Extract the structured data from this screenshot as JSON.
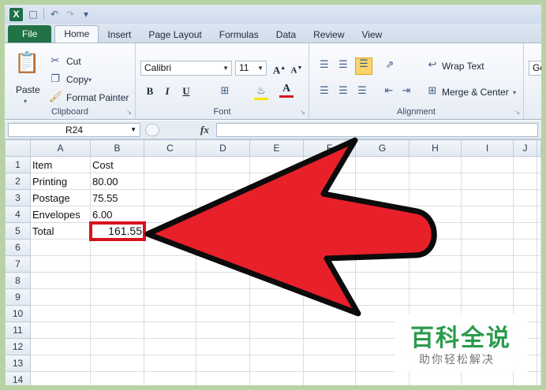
{
  "app": {
    "accent": "#217346",
    "highlight": "#d8121e"
  },
  "qat": {
    "logo": "X",
    "icons": [
      "save-icon",
      "undo-icon",
      "redo-icon",
      "customize-icon"
    ]
  },
  "tabs": [
    "File",
    "Home",
    "Insert",
    "Page Layout",
    "Formulas",
    "Data",
    "Review",
    "View"
  ],
  "ribbon": {
    "clipboard": {
      "paste": "Paste",
      "cut": "Cut",
      "copy": "Copy",
      "format_painter": "Format Painter",
      "label": "Clipboard"
    },
    "font": {
      "name": "Calibri",
      "size": "11",
      "label": "Font"
    },
    "alignment": {
      "wrap": "Wrap Text",
      "merge": "Merge & Center",
      "label": "Alignment"
    },
    "number": {
      "format": "Ge"
    }
  },
  "formula_bar": {
    "name_box": "R24",
    "fx": "fx",
    "value": ""
  },
  "grid": {
    "columns": [
      "A",
      "B",
      "C",
      "D",
      "E",
      "F",
      "G",
      "H",
      "I",
      "J"
    ],
    "rows": [
      {
        "n": "1",
        "a": "Item",
        "b": "Cost"
      },
      {
        "n": "2",
        "a": "Printing",
        "b": "80.00"
      },
      {
        "n": "3",
        "a": "Postage",
        "b": "75.55"
      },
      {
        "n": "4",
        "a": "Envelopes",
        "b": "6.00"
      },
      {
        "n": "5",
        "a": "Total",
        "b": "161.55"
      },
      {
        "n": "6",
        "a": "",
        "b": ""
      },
      {
        "n": "7",
        "a": "",
        "b": ""
      },
      {
        "n": "8",
        "a": "",
        "b": ""
      },
      {
        "n": "9",
        "a": "",
        "b": ""
      },
      {
        "n": "10",
        "a": "",
        "b": ""
      },
      {
        "n": "11",
        "a": "",
        "b": ""
      },
      {
        "n": "12",
        "a": "",
        "b": ""
      },
      {
        "n": "13",
        "a": "",
        "b": ""
      },
      {
        "n": "14",
        "a": "",
        "b": ""
      }
    ]
  },
  "watermark": {
    "title": "百科全说",
    "subtitle": "助你轻松解决"
  }
}
